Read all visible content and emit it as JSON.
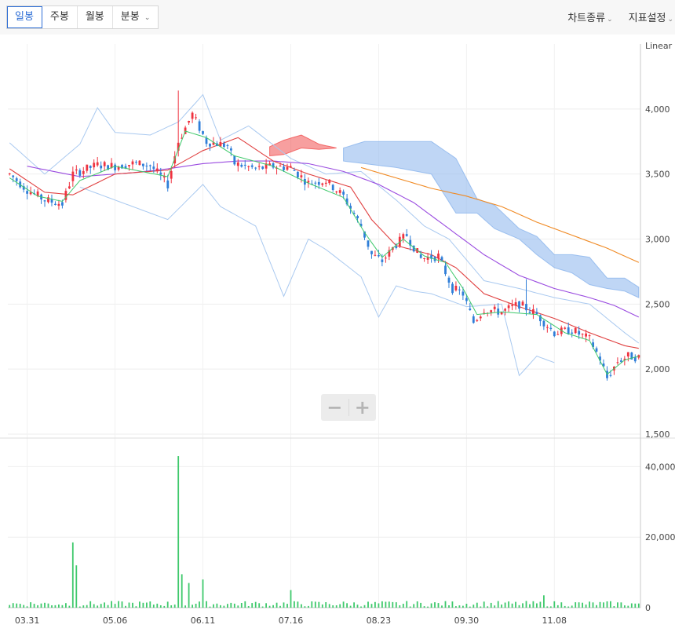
{
  "tabs": [
    {
      "label": "일봉",
      "active": true
    },
    {
      "label": "주봉",
      "active": false
    },
    {
      "label": "월봉",
      "active": false
    },
    {
      "label": "분봉",
      "active": false,
      "dropdown": true
    }
  ],
  "menu": {
    "chart_type": "차트종류",
    "indicator_settings": "지표설정"
  },
  "zoom": {
    "minus": "−",
    "plus": "+"
  },
  "colors": {
    "up": "#ef3340",
    "down": "#2f7ed8",
    "volume": "#3ec96b",
    "ma5": "#3ec96b",
    "ma20": "#e04040",
    "ma60": "#9a4be0",
    "ma120": "#f08a24",
    "bollinger": "#a9c9f0",
    "cloud_bull": "#f05050",
    "cloud_bear": "#8ab4ec"
  },
  "chart_data": {
    "type": "candlestick",
    "scale_label": "Linear",
    "price_axis": {
      "ticks": [
        "1,500",
        "2,000",
        "2,500",
        "3,000",
        "3,500",
        "4,000"
      ],
      "range": [
        1500,
        4500
      ]
    },
    "volume_axis": {
      "ticks": [
        "0",
        "20,000,0",
        "40,000,0"
      ],
      "range": [
        0,
        47000000
      ]
    },
    "x_ticks": [
      "03.31",
      "05.06",
      "06.11",
      "07.16",
      "08.23",
      "09.30",
      "11.08"
    ],
    "x_tick_index": [
      5,
      30,
      55,
      80,
      105,
      130,
      155
    ],
    "price_points": [
      [
        0,
        3500
      ],
      [
        5,
        3380
      ],
      [
        10,
        3300
      ],
      [
        15,
        3270
      ],
      [
        18,
        3500
      ],
      [
        25,
        3570
      ],
      [
        30,
        3560
      ],
      [
        35,
        3580
      ],
      [
        40,
        3570
      ],
      [
        45,
        3420
      ],
      [
        48,
        3750
      ],
      [
        52,
        3960
      ],
      [
        56,
        3750
      ],
      [
        62,
        3720
      ],
      [
        64,
        3580
      ],
      [
        70,
        3540
      ],
      [
        75,
        3560
      ],
      [
        80,
        3550
      ],
      [
        85,
        3430
      ],
      [
        90,
        3450
      ],
      [
        95,
        3330
      ],
      [
        100,
        3100
      ],
      [
        103,
        2880
      ],
      [
        106,
        2830
      ],
      [
        110,
        2960
      ],
      [
        113,
        3030
      ],
      [
        117,
        2850
      ],
      [
        122,
        2870
      ],
      [
        126,
        2620
      ],
      [
        129,
        2580
      ],
      [
        132,
        2360
      ],
      [
        135,
        2460
      ],
      [
        140,
        2440
      ],
      [
        145,
        2500
      ],
      [
        150,
        2420
      ],
      [
        155,
        2280
      ],
      [
        160,
        2300
      ],
      [
        165,
        2230
      ],
      [
        168,
        2080
      ],
      [
        170,
        1930
      ],
      [
        173,
        2060
      ],
      [
        176,
        2100
      ],
      [
        179,
        2090
      ]
    ],
    "volume_spikes": [
      [
        18,
        18500000
      ],
      [
        19,
        12000000
      ],
      [
        48,
        43000000
      ],
      [
        49,
        9500000
      ],
      [
        51,
        7000000
      ],
      [
        55,
        8000000
      ],
      [
        80,
        5000000
      ],
      [
        152,
        3500000
      ]
    ],
    "ma_lines": {
      "ma5": [
        [
          0,
          3470
        ],
        [
          8,
          3330
        ],
        [
          15,
          3290
        ],
        [
          20,
          3450
        ],
        [
          30,
          3560
        ],
        [
          45,
          3480
        ],
        [
          50,
          3830
        ],
        [
          56,
          3780
        ],
        [
          64,
          3640
        ],
        [
          75,
          3560
        ],
        [
          85,
          3430
        ],
        [
          95,
          3320
        ],
        [
          101,
          3050
        ],
        [
          106,
          2860
        ],
        [
          112,
          3000
        ],
        [
          118,
          2870
        ],
        [
          124,
          2820
        ],
        [
          129,
          2620
        ],
        [
          133,
          2420
        ],
        [
          140,
          2440
        ],
        [
          150,
          2420
        ],
        [
          158,
          2280
        ],
        [
          165,
          2220
        ],
        [
          170,
          1960
        ],
        [
          175,
          2070
        ],
        [
          179,
          2100
        ]
      ],
      "ma20": [
        [
          0,
          3540
        ],
        [
          10,
          3360
        ],
        [
          18,
          3340
        ],
        [
          30,
          3500
        ],
        [
          45,
          3530
        ],
        [
          55,
          3680
        ],
        [
          65,
          3780
        ],
        [
          75,
          3600
        ],
        [
          85,
          3500
        ],
        [
          97,
          3400
        ],
        [
          103,
          3150
        ],
        [
          110,
          2950
        ],
        [
          120,
          2880
        ],
        [
          127,
          2780
        ],
        [
          135,
          2580
        ],
        [
          145,
          2480
        ],
        [
          155,
          2390
        ],
        [
          165,
          2280
        ],
        [
          175,
          2180
        ],
        [
          179,
          2160
        ]
      ],
      "ma60": [
        [
          5,
          3560
        ],
        [
          20,
          3480
        ],
        [
          35,
          3510
        ],
        [
          45,
          3540
        ],
        [
          55,
          3580
        ],
        [
          65,
          3600
        ],
        [
          75,
          3600
        ],
        [
          85,
          3580
        ],
        [
          95,
          3520
        ],
        [
          105,
          3420
        ],
        [
          115,
          3280
        ],
        [
          125,
          3080
        ],
        [
          135,
          2880
        ],
        [
          145,
          2720
        ],
        [
          155,
          2620
        ],
        [
          165,
          2550
        ],
        [
          172,
          2490
        ],
        [
          179,
          2400
        ]
      ],
      "ma120": [
        [
          100,
          3550
        ],
        [
          110,
          3470
        ],
        [
          120,
          3390
        ],
        [
          130,
          3330
        ],
        [
          140,
          3250
        ],
        [
          150,
          3130
        ],
        [
          160,
          3030
        ],
        [
          170,
          2930
        ],
        [
          179,
          2820
        ]
      ]
    },
    "bollinger": {
      "upper": [
        [
          0,
          3740
        ],
        [
          10,
          3500
        ],
        [
          20,
          3730
        ],
        [
          25,
          4010
        ],
        [
          30,
          3820
        ],
        [
          40,
          3800
        ],
        [
          48,
          3900
        ],
        [
          55,
          4110
        ],
        [
          60,
          3760
        ],
        [
          68,
          3870
        ],
        [
          80,
          3620
        ],
        [
          90,
          3500
        ],
        [
          100,
          3520
        ],
        [
          110,
          3300
        ],
        [
          118,
          3100
        ],
        [
          125,
          3000
        ],
        [
          135,
          2680
        ],
        [
          145,
          2620
        ],
        [
          155,
          2550
        ],
        [
          165,
          2500
        ],
        [
          175,
          2280
        ],
        [
          179,
          2200
        ]
      ],
      "lower": [
        [
          20,
          3400
        ],
        [
          30,
          3300
        ],
        [
          45,
          3150
        ],
        [
          55,
          3420
        ],
        [
          60,
          3250
        ],
        [
          70,
          3100
        ],
        [
          78,
          2560
        ],
        [
          85,
          3000
        ],
        [
          90,
          2920
        ],
        [
          100,
          2710
        ],
        [
          105,
          2400
        ],
        [
          110,
          2640
        ],
        [
          115,
          2600
        ],
        [
          120,
          2580
        ],
        [
          130,
          2480
        ],
        [
          140,
          2500
        ],
        [
          145,
          1950
        ],
        [
          150,
          2100
        ],
        [
          155,
          2050
        ]
      ]
    },
    "ichimoku_cloud": {
      "bull": [
        [
          74,
          3710,
          3640
        ],
        [
          78,
          3760,
          3650
        ],
        [
          83,
          3800,
          3700
        ],
        [
          88,
          3730,
          3690
        ],
        [
          93,
          3700,
          3700
        ]
      ],
      "bear": [
        [
          95,
          3700,
          3600
        ],
        [
          101,
          3750,
          3580
        ],
        [
          110,
          3750,
          3550
        ],
        [
          120,
          3750,
          3500
        ],
        [
          127,
          3620,
          3200
        ],
        [
          133,
          3310,
          3200
        ],
        [
          138,
          3260,
          3080
        ],
        [
          145,
          3080,
          3000
        ],
        [
          150,
          3020,
          2880
        ],
        [
          155,
          2880,
          2780
        ],
        [
          160,
          2880,
          2740
        ],
        [
          165,
          2860,
          2650
        ],
        [
          170,
          2700,
          2620
        ],
        [
          175,
          2700,
          2600
        ],
        [
          179,
          2630,
          2550
        ]
      ]
    }
  }
}
